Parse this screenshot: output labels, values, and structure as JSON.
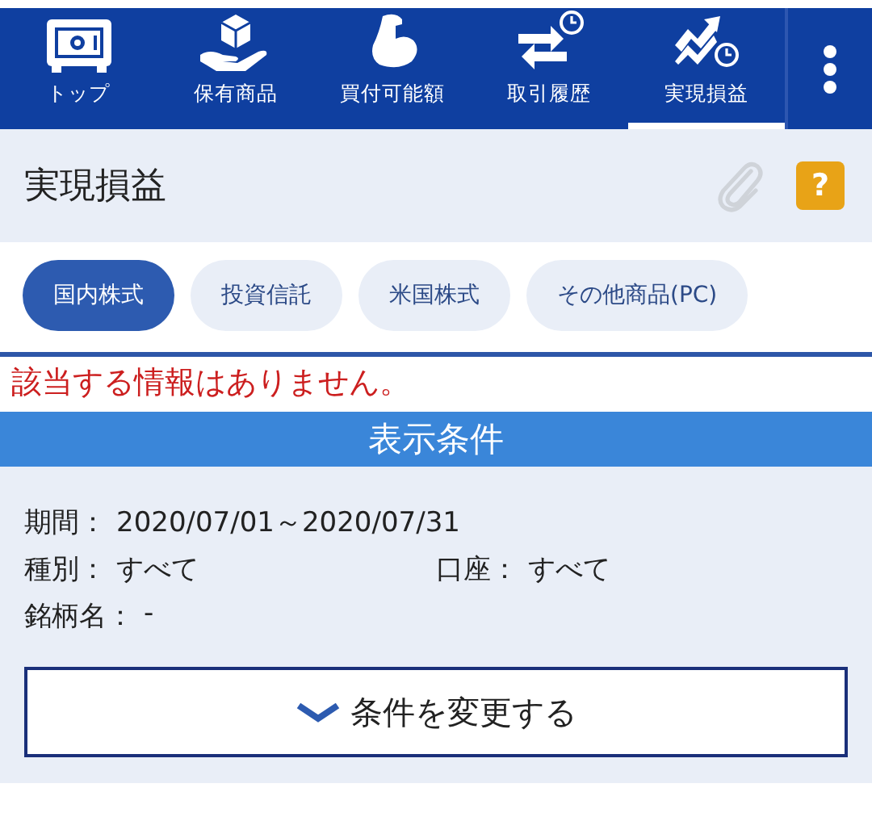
{
  "nav": {
    "tabs": [
      {
        "label": "トップ",
        "selected": false
      },
      {
        "label": "保有商品",
        "selected": false
      },
      {
        "label": "買付可能額",
        "selected": false
      },
      {
        "label": "取引履歴",
        "selected": false
      },
      {
        "label": "実現損益",
        "selected": true
      }
    ]
  },
  "header": {
    "title": "実現損益",
    "help": "?"
  },
  "filters": [
    {
      "label": "国内株式",
      "selected": true
    },
    {
      "label": "投資信託",
      "selected": false
    },
    {
      "label": "米国株式",
      "selected": false
    },
    {
      "label": "その他商品(PC)",
      "selected": false
    }
  ],
  "message": "該当する情報はありません。",
  "conditions": {
    "title": "表示条件",
    "rows": [
      [
        {
          "label": "期間：",
          "value": "2020/07/01～2020/07/31"
        }
      ],
      [
        {
          "label": "種別：",
          "value": "すべて"
        },
        {
          "label": "口座：",
          "value": "すべて"
        }
      ],
      [
        {
          "label": "銘柄名：",
          "value": "-"
        }
      ]
    ],
    "button": "条件を変更する"
  }
}
